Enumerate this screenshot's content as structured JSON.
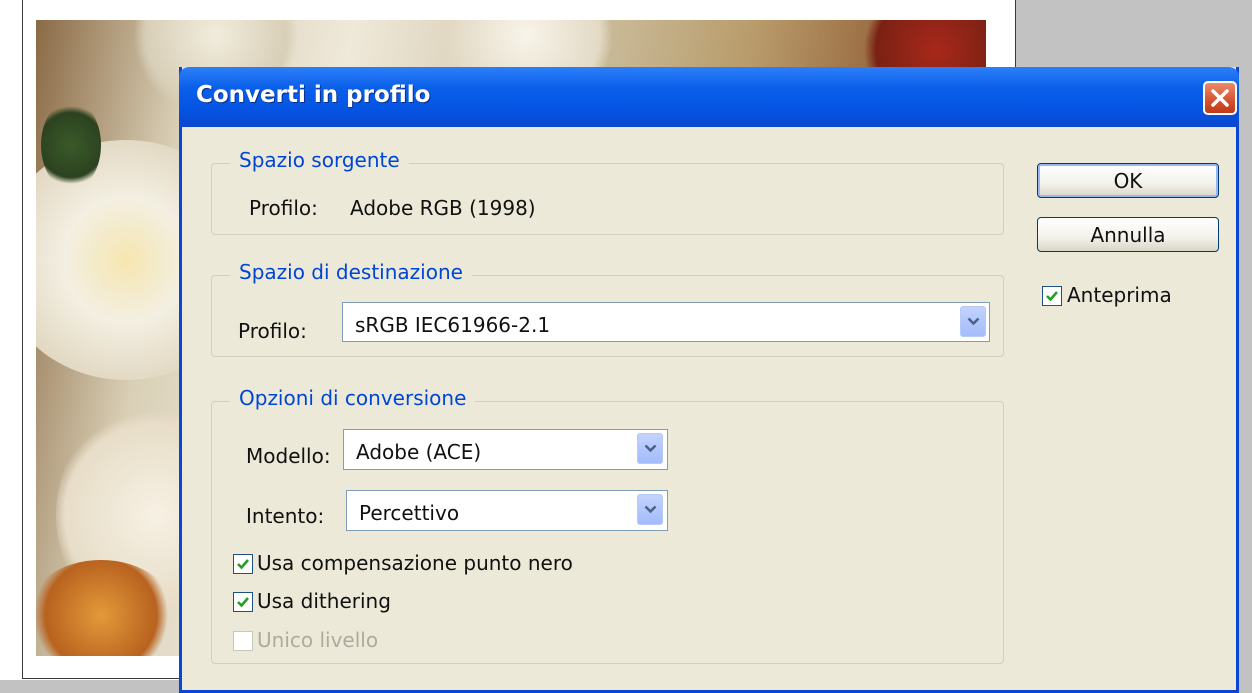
{
  "colors": {
    "titlebar": "#0554e3",
    "dialog_bg": "#ece9d8",
    "legend_text": "#0046d5",
    "close_button": "#d4512e",
    "checkmark": "#21a121",
    "disabled_text": "#acab9f"
  },
  "dialog": {
    "title": "Converti in profilo",
    "close_icon": "close-icon"
  },
  "source_space": {
    "legend": "Spazio sorgente",
    "profile_label": "Profilo:",
    "profile_value": "Adobe RGB (1998)"
  },
  "destination_space": {
    "legend": "Spazio di destinazione",
    "profile_label": "Profilo:",
    "profile_value": "sRGB IEC61966-2.1"
  },
  "conversion_options": {
    "legend": "Opzioni di conversione",
    "engine_label": "Modello:",
    "engine_value": "Adobe (ACE)",
    "intent_label": "Intento:",
    "intent_value": "Percettivo",
    "black_point_label": "Usa compensazione punto nero",
    "black_point_checked": true,
    "dither_label": "Usa dithering",
    "dither_checked": true,
    "flatten_label": "Unico livello",
    "flatten_checked": false,
    "flatten_enabled": false
  },
  "buttons": {
    "ok_label": "OK",
    "cancel_label": "Annulla"
  },
  "preview": {
    "label": "Anteprima",
    "checked": true
  }
}
